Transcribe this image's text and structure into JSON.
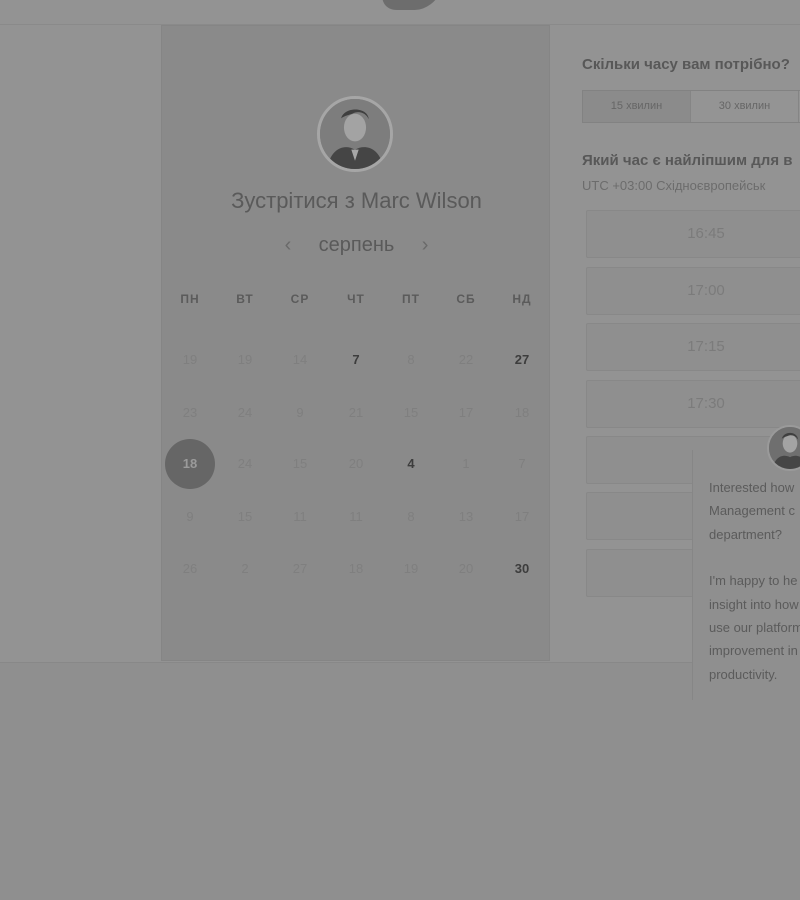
{
  "left_panel": {
    "title": "Зустрітися з Marc Wilson",
    "month": "серпень",
    "prev_icon": "chevron-left-icon",
    "next_icon": "chevron-right-icon",
    "weekdays": [
      "ПН",
      "ВТ",
      "СР",
      "ЧТ",
      "ПТ",
      "СБ",
      "НД"
    ],
    "days": [
      [
        "19",
        "19",
        "14",
        "7",
        "8",
        "22",
        "27"
      ],
      [
        "23",
        "24",
        "9",
        "21",
        "15",
        "17",
        "18"
      ],
      [
        "18",
        "24",
        "15",
        "20",
        "4",
        "1",
        "7"
      ],
      [
        "9",
        "15",
        "11",
        "11",
        "8",
        "13",
        "17"
      ],
      [
        "26",
        "2",
        "27",
        "18",
        "19",
        "20",
        "30"
      ]
    ],
    "active_days": [
      "7",
      "27",
      "4",
      "30"
    ],
    "selected_day": "18"
  },
  "duration": {
    "title": "Скільки часу вам потрібно?",
    "options": [
      "15 хвилин",
      "30 хвилин"
    ],
    "selected": "15 хвилин"
  },
  "time": {
    "title": "Який час є найліпшим для в",
    "timezone": "UTC +03:00 Східноєвропейськ",
    "slots": [
      "16:45",
      "17:00",
      "17:15",
      "17:30",
      "",
      "",
      ""
    ]
  },
  "chat": {
    "line1": "Interested how",
    "line2": "Management c",
    "line3": "department?",
    "line4": "I'm happy to he",
    "line5": "insight into how",
    "line6": "use our platform",
    "line7": "improvement in",
    "line8": "productivity."
  },
  "colors": {
    "overlay": "#8f8f8f",
    "selected_day_bg": "#666666"
  }
}
